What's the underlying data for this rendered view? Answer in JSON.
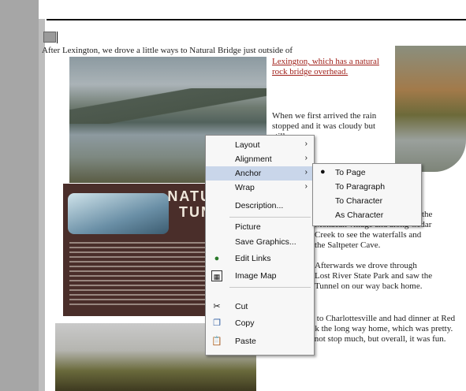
{
  "paragraphs": [
    {
      "text": "After Lexington, we drove a little ways to Natural Bridge just outside of"
    },
    {
      "text": "Lexington, which has a natural rock bridge overhead."
    },
    {
      "text": "When we first arrived the rain stopped and it was cloudy but still warm."
    },
    {
      "text": "We walked down the trail past the Monacan village and along Cedar Creek to see the waterfalls and the Saltpeter Cave."
    },
    {
      "text": "Afterwards we drove through Lost River State Park and saw the Tunnel on our way back home."
    },
    {
      "text": "We went back to Charlottesville and had dinner at Red Robin and took the long way home, which was pretty. We really did not stop much, but overall, it was fun."
    }
  ],
  "sign": {
    "title": "NATURAL\nTUNNEL"
  },
  "context_menu": {
    "items": [
      {
        "label": "Layout",
        "submenu": true
      },
      {
        "label": "Alignment",
        "submenu": true
      },
      {
        "label": "Anchor",
        "submenu": true,
        "highlighted": true
      },
      {
        "label": "Wrap",
        "submenu": true
      },
      {
        "label": "Description...",
        "submenu": false
      },
      {
        "label": "Picture",
        "submenu": false
      },
      {
        "label": "Save Graphics...",
        "submenu": false
      },
      {
        "label": "Edit Links",
        "submenu": false
      },
      {
        "label": "Image Map",
        "submenu": false
      },
      {
        "label": "Cut",
        "submenu": false
      },
      {
        "label": "Copy",
        "submenu": false
      },
      {
        "label": "Paste",
        "submenu": false
      }
    ],
    "icons": {
      "edit_links": "link-icon",
      "image_map": "image-map-icon",
      "cut": "scissors-icon",
      "copy": "copy-icon",
      "paste": "paste-icon"
    }
  },
  "anchor_submenu": {
    "items": [
      {
        "label": "To Page",
        "checked": true
      },
      {
        "label": "To Paragraph",
        "checked": false
      },
      {
        "label": "To Character",
        "checked": false
      },
      {
        "label": "As Character",
        "checked": false
      }
    ]
  },
  "colors": {
    "gutter": "#a6a6a6",
    "link": "#a0201a",
    "menu_highlight": "#c9d6ea"
  }
}
